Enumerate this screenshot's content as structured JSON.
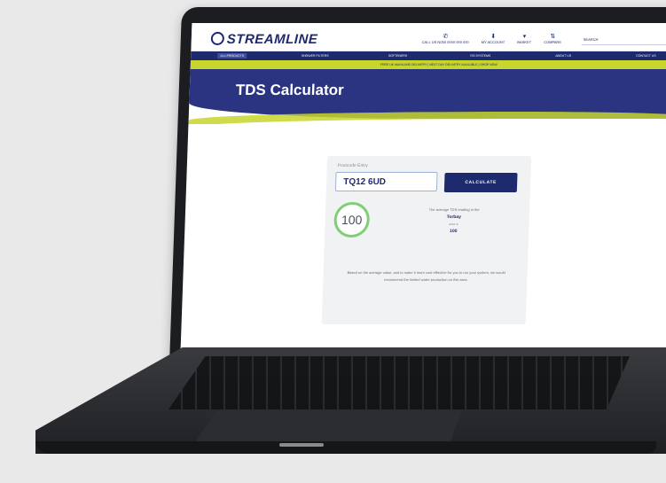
{
  "site": {
    "logo": "STREAMLINE",
    "header_links": [
      {
        "icon": "phone-icon",
        "label": "CALL US NOW 0000 000 000"
      },
      {
        "icon": "account-icon",
        "label": "MY ACCOUNT"
      },
      {
        "icon": "basket-icon",
        "label": "BASKET"
      },
      {
        "icon": "compare-icon",
        "label": "COMPARE"
      }
    ],
    "search_placeholder": "SEARCH",
    "nav": [
      "ALL PRODUCTS",
      "SHOWER FILTERS",
      "SOFTENERS",
      "RO SYSTEMS",
      "ABOUT US",
      "CONTACT US"
    ],
    "promo": "FREE UK MAINLAND DELIVERY | NEXT DAY DELIVERY AVAILABLE | SHOP NOW"
  },
  "hero": {
    "title": "TDS Calculator"
  },
  "calculator": {
    "postcode_label": "Postcode Entry",
    "postcode_value": "TQ12 6UD",
    "button_label": "CALCULATE",
    "gauge_value": "100",
    "result_line": "The average TDS reading in the",
    "town": "Torbay",
    "is_label": "area is",
    "result_value": "100",
    "advice": "Based on the average value, and to make it more cost-effective for you to run your system, we would recommend the limited water-production on this area."
  },
  "colors": {
    "brand_navy": "#1e2a6e",
    "accent_lime": "#c7d52c",
    "gauge_green": "#7fcf77"
  }
}
